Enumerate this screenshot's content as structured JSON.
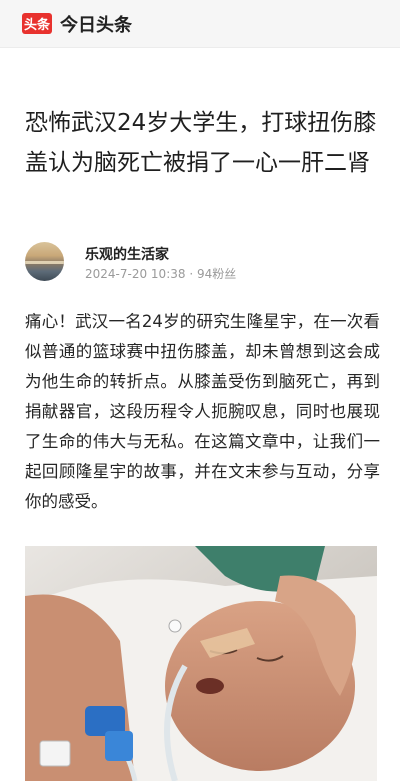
{
  "app": {
    "logo_text": "头条",
    "title": "今日头条"
  },
  "article": {
    "headline": "恐怖武汉24岁大学生，打球扭伤膝盖认为脑死亡被捐了一心一肝二肾",
    "author": {
      "name": "乐观的生活家",
      "date": "2024-7-20 10:38",
      "separator": " · ",
      "followers": "94粉丝"
    },
    "body": "痛心！武汉一名24岁的研究生隆星宇，在一次看似普通的篮球赛中扭伤膝盖，却未曾想到这会成为他生命的转折点。从膝盖受伤到脑死亡，再到捐献器官，这段历程令人扼腕叹息，同时也展现了生命的伟大与无私。在这篇文章中，让我们一起回顾隆星宇的故事，并在文末参与互动，分享你的感受。"
  },
  "colors": {
    "brand_red": "#e8322e",
    "meta_gray": "#9a9a9a"
  }
}
